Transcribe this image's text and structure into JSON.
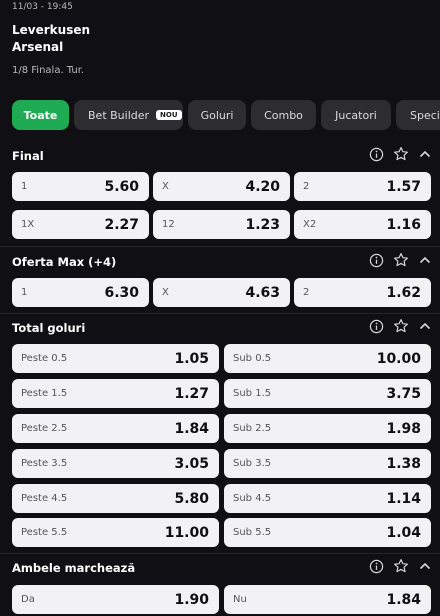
{
  "match": {
    "date": "11/03 - 19:45",
    "team1": "Leverkusen",
    "team2": "Arsenal",
    "round": "1/8 Finala. Tur."
  },
  "tabs": [
    {
      "label": "Toate",
      "active": true
    },
    {
      "label": "Bet Builder",
      "badge": "NOU"
    },
    {
      "label": "Goluri"
    },
    {
      "label": "Combo"
    },
    {
      "label": "Jucatori"
    },
    {
      "label": "Speci"
    }
  ],
  "markets": {
    "final": {
      "title": "Final",
      "odds": [
        {
          "label": "1",
          "value": "5.60"
        },
        {
          "label": "X",
          "value": "4.20"
        },
        {
          "label": "2",
          "value": "1.57"
        },
        {
          "label": "1X",
          "value": "2.27"
        },
        {
          "label": "12",
          "value": "1.23"
        },
        {
          "label": "X2",
          "value": "1.16"
        }
      ]
    },
    "oferta": {
      "title": "Oferta Max (+4)",
      "odds": [
        {
          "label": "1",
          "value": "6.30"
        },
        {
          "label": "X",
          "value": "4.63"
        },
        {
          "label": "2",
          "value": "1.62"
        }
      ]
    },
    "total": {
      "title": "Total goluri",
      "odds": [
        {
          "label": "Peste 0.5",
          "value": "1.05"
        },
        {
          "label": "Sub 0.5",
          "value": "10.00"
        },
        {
          "label": "Peste 1.5",
          "value": "1.27"
        },
        {
          "label": "Sub 1.5",
          "value": "3.75"
        },
        {
          "label": "Peste 2.5",
          "value": "1.84"
        },
        {
          "label": "Sub 2.5",
          "value": "1.98"
        },
        {
          "label": "Peste 3.5",
          "value": "3.05"
        },
        {
          "label": "Sub 3.5",
          "value": "1.38"
        },
        {
          "label": "Peste 4.5",
          "value": "5.80"
        },
        {
          "label": "Sub 4.5",
          "value": "1.14"
        },
        {
          "label": "Peste 5.5",
          "value": "11.00"
        },
        {
          "label": "Sub 5.5",
          "value": "1.04"
        }
      ]
    },
    "ambele": {
      "title": "Ambele marchează",
      "odds": [
        {
          "label": "Da",
          "value": "1.90"
        },
        {
          "label": "Nu",
          "value": "1.84"
        }
      ]
    }
  },
  "icons": [
    "info-icon",
    "star-icon",
    "chevron-up-icon"
  ],
  "colors": {
    "background": "#101014",
    "accent": "#1faa54",
    "tab": "#2c2c31",
    "odd": "#f2f2f4"
  }
}
